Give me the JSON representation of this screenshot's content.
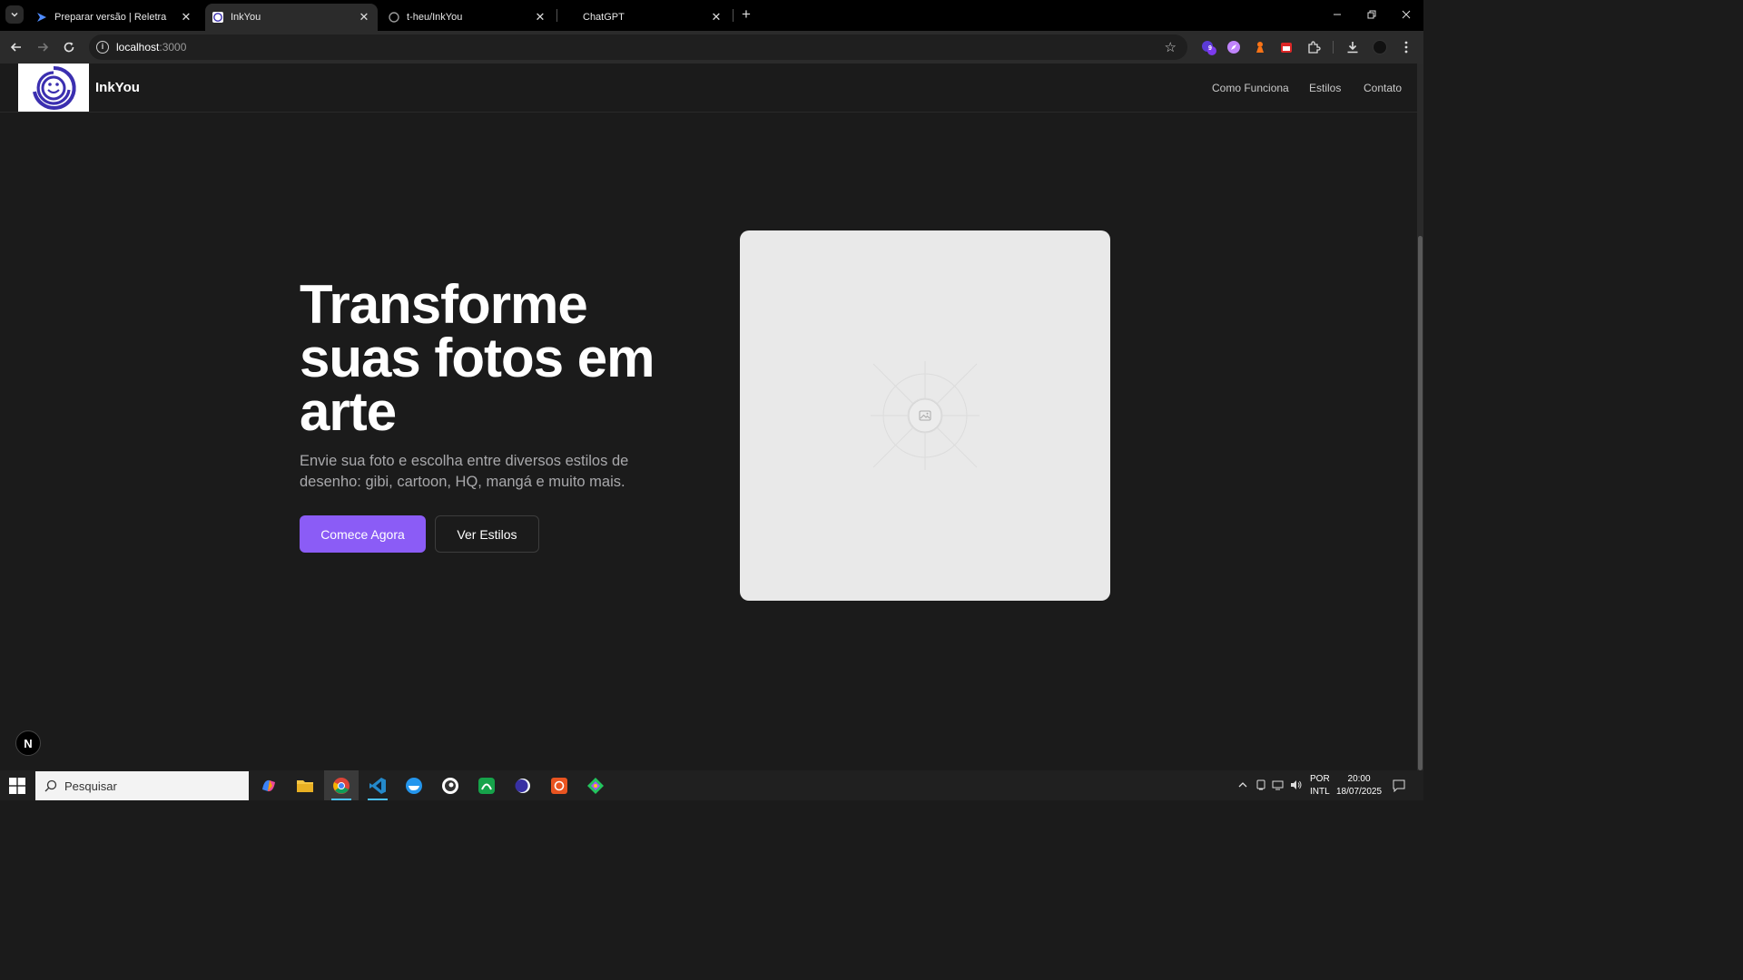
{
  "browser": {
    "tabs": [
      {
        "title": "Preparar versão | Reletra",
        "icon": "reletra-icon",
        "active": false
      },
      {
        "title": "InkYou",
        "icon": "inkyou-favicon",
        "active": true
      },
      {
        "title": "t-heu/InkYou",
        "icon": "github-icon",
        "active": false
      },
      {
        "title": "ChatGPT",
        "icon": "chatgpt-icon",
        "active": false
      }
    ],
    "url_host": "localhost",
    "url_port": ":3000",
    "extension_badge": "9"
  },
  "site": {
    "brand": "InkYou",
    "nav": [
      "Como Funciona",
      "Estilos",
      "Contato"
    ],
    "hero": {
      "title_lines": [
        "Transforme",
        "suas fotos em",
        "arte"
      ],
      "subtitle": "Envie sua foto e escolha entre diversos estilos de desenho: gibi, cartoon, HQ, mangá e muito mais.",
      "primary_cta": "Comece Agora",
      "secondary_cta": "Ver Estilos"
    },
    "placeholder_icon": "image-icon",
    "dev_badge": "N"
  },
  "colors": {
    "accent": "#8b5cf6",
    "background": "#1b1b1b",
    "placeholder": "#e9e9e9"
  },
  "taskbar": {
    "search_placeholder": "Pesquisar",
    "language_line1": "POR",
    "language_line2": "INTL",
    "time": "20:00",
    "date": "18/07/2025"
  }
}
